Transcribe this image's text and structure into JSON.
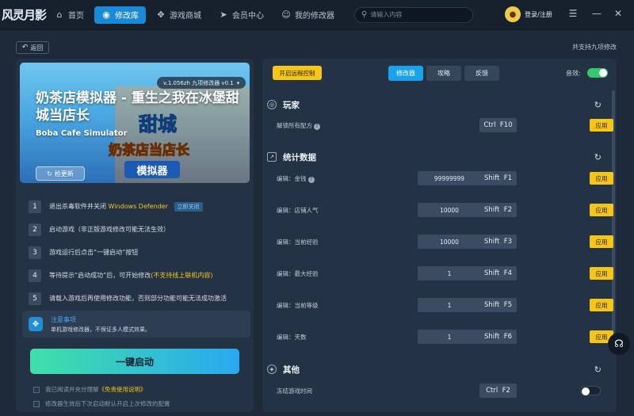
{
  "app": {
    "logo_text": "风灵月影"
  },
  "nav": {
    "items": [
      {
        "label": "首页",
        "icon": "home-icon"
      },
      {
        "label": "修改库",
        "icon": "library-icon",
        "active": true
      },
      {
        "label": "游戏商城",
        "icon": "gamepad-icon"
      },
      {
        "label": "会员中心",
        "icon": "send-icon"
      },
      {
        "label": "我的修改器",
        "icon": "smile-icon"
      }
    ],
    "search_placeholder": "请输入内容",
    "login_label": "登录/注册"
  },
  "subheader": {
    "back_label": "返回",
    "support_count": "共支持九项修改"
  },
  "game": {
    "version": "v.1.056zh 九项修改器 v0.1",
    "title": "奶茶店模拟器 - 重生之我在冰堡甜城当店长",
    "subtitle": "Boba Cafe Simulator",
    "banner_logo_line1": "甜城",
    "banner_logo_line2": "奶茶店当店长",
    "banner_logo_line3": "模拟器",
    "update_label": "检更新"
  },
  "steps": [
    {
      "num": "1",
      "text": "退出杀毒软件并关闭",
      "highlight": "Windows Defender",
      "tag": "立即关闭"
    },
    {
      "num": "2",
      "text": "启动游戏（非正版游戏修改可能无法生效）"
    },
    {
      "num": "3",
      "text": "游戏运行后点击“一键启动”按钮"
    },
    {
      "num": "4",
      "text": "等待提示“启动成功”后，可开始修改",
      "highlight": "(不支持线上联机内容)"
    },
    {
      "num": "5",
      "text": "请载入游戏后再使用修改功能，否则部分功能可能无法成功激活"
    }
  ],
  "notice": {
    "title": "注意事项",
    "text": "单机游戏修改器，不保证多人模式效果。"
  },
  "start_label": "一键启动",
  "checks": {
    "agree_prefix": "我已阅读并充分理解",
    "agree_link": "《免责使用说明》",
    "remember": "修改器生效后下次启动默认开启上次修改的配置"
  },
  "right": {
    "remote_label": "开启远程控制",
    "tabs": [
      "修改器",
      "攻略",
      "反馈"
    ],
    "sound_label": "音效:",
    "sections": [
      {
        "title": "玩家",
        "rows": [
          {
            "label": "解锁所有配方",
            "hotkey": [
              "Ctrl",
              "F10"
            ],
            "action": "应用"
          }
        ]
      },
      {
        "title": "统计数据",
        "rows": [
          {
            "label": "编辑：金钱",
            "value": "99999999",
            "hotkey": [
              "Shift",
              "F1"
            ],
            "action": "应用"
          },
          {
            "label": "编辑：店铺人气",
            "value": "10000",
            "hotkey": [
              "Shift",
              "F2"
            ],
            "action": "应用"
          },
          {
            "label": "编辑：当前经验",
            "value": "10000",
            "hotkey": [
              "Shift",
              "F3"
            ],
            "action": "应用"
          },
          {
            "label": "编辑：最大经验",
            "value": "1",
            "hotkey": [
              "Shift",
              "F4"
            ],
            "action": "应用"
          },
          {
            "label": "编辑：当前等级",
            "value": "1",
            "hotkey": [
              "Shift",
              "F5"
            ],
            "action": "应用"
          },
          {
            "label": "编辑：天数",
            "value": "1",
            "hotkey": [
              "Shift",
              "F6"
            ],
            "action": "应用"
          }
        ]
      },
      {
        "title": "其他",
        "rows": [
          {
            "label": "冻结游戏时间",
            "hotkey": [
              "Ctrl",
              "F2"
            ],
            "toggle": "off"
          }
        ]
      }
    ]
  }
}
